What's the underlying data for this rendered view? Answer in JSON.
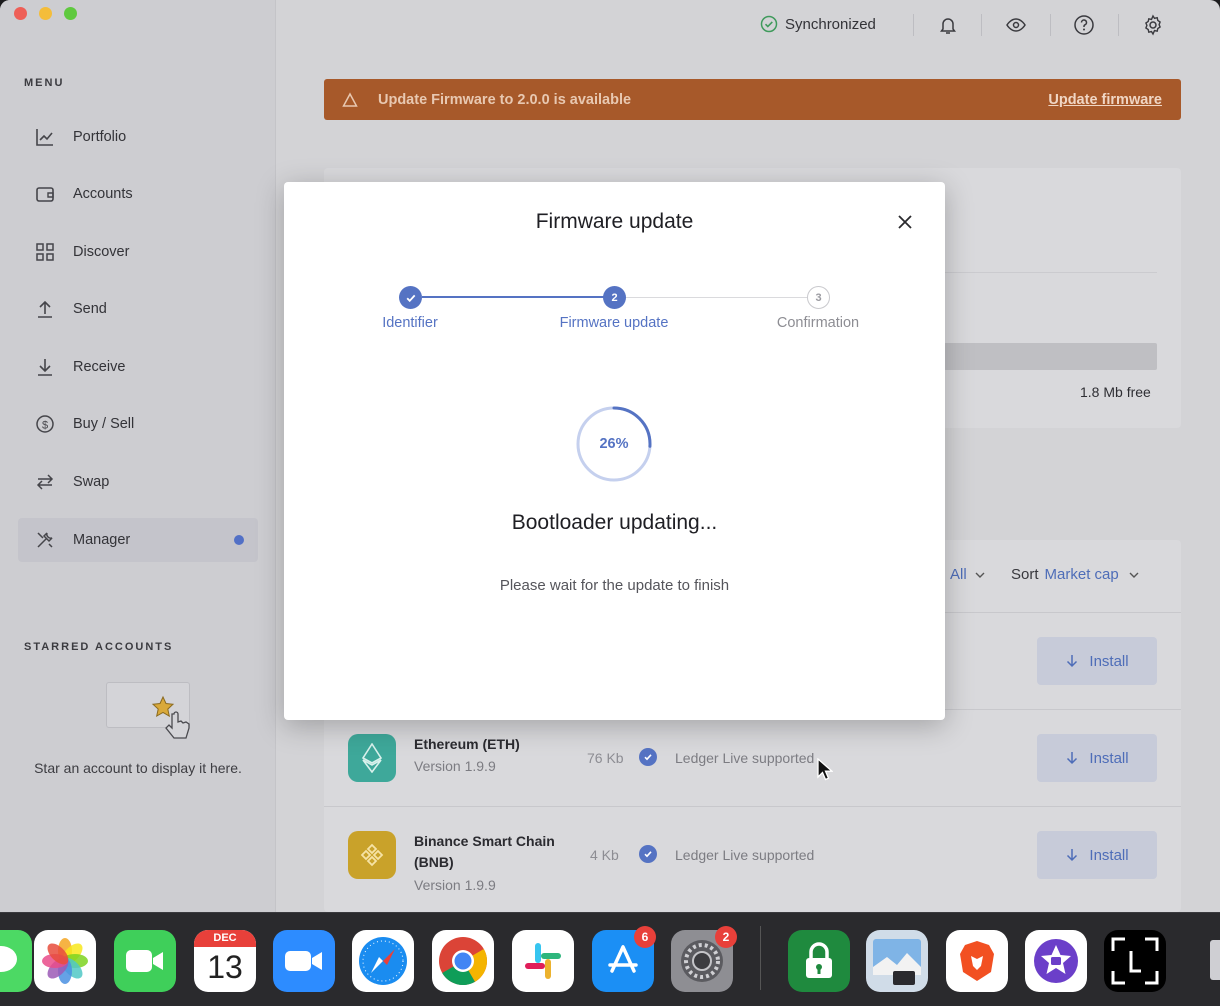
{
  "sidebar": {
    "menu_title": "MENU",
    "items": [
      {
        "label": "Portfolio",
        "icon": "chart-line-icon"
      },
      {
        "label": "Accounts",
        "icon": "wallet-icon"
      },
      {
        "label": "Discover",
        "icon": "grid-icon"
      },
      {
        "label": "Send",
        "icon": "arrow-up-icon"
      },
      {
        "label": "Receive",
        "icon": "arrow-down-icon"
      },
      {
        "label": "Buy / Sell",
        "icon": "dollar-circle-icon"
      },
      {
        "label": "Swap",
        "icon": "swap-icon"
      },
      {
        "label": "Manager",
        "icon": "tools-icon",
        "active": true
      }
    ],
    "starred_title": "STARRED ACCOUNTS",
    "starred_empty": "Star an account to display it here."
  },
  "topbar": {
    "sync_label": "Synchronized"
  },
  "banner": {
    "message": "Update Firmware to 2.0.0 is available",
    "link": "Update firmware"
  },
  "storage": {
    "free_label": "1.8 Mb free"
  },
  "catalog": {
    "filter_value": "All",
    "sort_label": "Sort",
    "sort_value": "Market cap",
    "apps": [
      {
        "name": "Ethereum (ETH)",
        "version": "Version 1.9.9",
        "size": "76 Kb",
        "support": "Ledger Live supported",
        "install": "Install",
        "color": "#3ea89a"
      },
      {
        "name": "Binance Smart Chain (BNB)",
        "version": "Version 1.9.9",
        "size": "4 Kb",
        "support": "Ledger Live supported",
        "install": "Install",
        "color": "#c9a22a"
      }
    ],
    "hidden_install": "Install"
  },
  "modal": {
    "title": "Firmware update",
    "steps": [
      {
        "number": "1",
        "label": "Identifier",
        "state": "done"
      },
      {
        "number": "2",
        "label": "Firmware update",
        "state": "active"
      },
      {
        "number": "3",
        "label": "Confirmation",
        "state": "pending"
      }
    ],
    "progress_percent": 26,
    "progress_text": "26%",
    "status": "Bootloader updating...",
    "substatus": "Please wait for the update to finish"
  },
  "dock": {
    "apps": [
      {
        "name": "Messages",
        "icon": "messages-icon"
      },
      {
        "name": "Photos",
        "icon": "photos-icon"
      },
      {
        "name": "FaceTime",
        "icon": "facetime-icon"
      },
      {
        "name": "Calendar",
        "icon": "calendar-icon",
        "month": "DEC",
        "day": "13"
      },
      {
        "name": "Zoom",
        "icon": "zoom-icon"
      },
      {
        "name": "Safari",
        "icon": "safari-icon"
      },
      {
        "name": "Chrome",
        "icon": "chrome-icon"
      },
      {
        "name": "Slack",
        "icon": "slack-icon"
      },
      {
        "name": "App Store",
        "icon": "app-store-icon",
        "badge": "6"
      },
      {
        "name": "System Preferences",
        "icon": "settings-icon",
        "badge": "2"
      },
      {
        "name": "Ledger Live",
        "icon": "ledger-lock-icon"
      },
      {
        "name": "Preview",
        "icon": "preview-icon"
      },
      {
        "name": "Brave",
        "icon": "brave-icon"
      },
      {
        "name": "iMovie",
        "icon": "imovie-icon"
      },
      {
        "name": "Ledger",
        "icon": "ledger-logo-icon"
      }
    ]
  },
  "colors": {
    "accent": "#5573c3",
    "banner": "#a7592a",
    "badge": "#e8403a"
  }
}
